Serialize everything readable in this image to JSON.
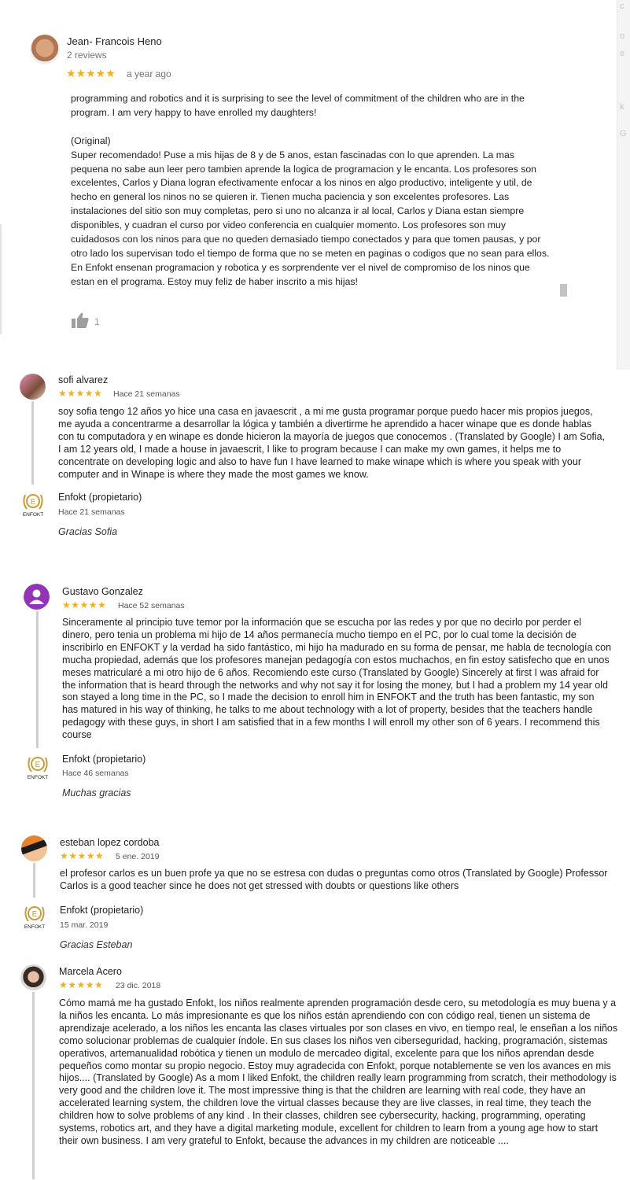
{
  "review1": {
    "name": "Jean- Francois Heno",
    "count": "2 reviews",
    "stars": "★★★★★",
    "date": "a year ago",
    "text": "programming and robotics and it is surprising to see the level of commitment of the children who are in the program. I am very happy to have enrolled my daughters!\n\n(Original)\nSuper recomendado! Puse a mis hijas de 8 y de 5 anos, estan fascinadas con lo que aprenden. La mas pequena no sabe aun leer pero tambien aprende la logica de programacion y le encanta. Los profesores son excelentes, Carlos y Diana logran efectivamente enfocar a los ninos en algo productivo, inteligente y util, de hecho en general los ninos no se quieren ir. Tienen mucha paciencia y son excelentes profesores. Las instalaciones del sitio son muy completas, pero si uno no alcanza ir al local, Carlos y Diana estan siempre disponibles, y cuadran el curso por video conferencia en cualquier momento. Los profesores son muy cuidadosos con los ninos para que no queden demasiado tiempo conectados y para que tomen pausas, y por otro lado los supervisan todo el tiempo de forma que no se meten en paginas o codigos que no sean para ellos. En Enfokt ensenan programacion y robotica y es sorprendente ver el nivel de compromiso de los ninos que estan en el programa. Estoy muy feliz de haber inscrito a mis hijas!",
    "likes": "1"
  },
  "review2": {
    "name": "sofi alvarez",
    "stars": "★★★★★",
    "date": "Hace 21 semanas",
    "text": "soy sofia tengo 12 años yo hice una casa en javaescrit , a mi me gusta programar porque puedo hacer mis propios juegos, me ayuda a concentrarme a desarrollar la lógica y también a divertirme he aprendido a hacer winape que es donde hablas con tu computadora y en winape es donde hicieron la mayoría de juegos que conocemos . (Translated by Google) I am Sofia, I am 12 years old, I made a house in javaescrit, I like to program because I can make my own games, it helps me to concentrate on developing logic and also to have fun I have learned to make winape which is where you speak with your computer and in Winape is where they made the most games we know.",
    "owner": "Enfokt (propietario)",
    "owner_date": "Hace 21 semanas",
    "reply": "Gracias Sofia"
  },
  "review3": {
    "name": "Gustavo Gonzalez",
    "stars": "★★★★★",
    "date": "Hace 52 semanas",
    "text": "Sinceramente al principio tuve temor por la información que se escucha por las redes y por que no decirlo por perder el dinero, pero tenia un problema mi hijo de 14 años permanecía mucho tiempo en el PC, por lo cual tome la decisión de inscribirlo en ENFOKT y la verdad ha sido fantástico, mi hijo ha madurado en su forma de pensar, me habla de tecnología con mucha propiedad, además que los profesores manejan pedagogía con estos muchachos, en fin estoy satisfecho que en unos meses matricularé a mi otro hijo de 6 años. Recomiendo este curso (Translated by Google) Sincerely at first I was afraid for the information that is heard through the networks and why not say it for losing the money, but I had a problem my 14 year old son stayed a long time in the PC, so I made the decision to enroll him in ENFOKT and the truth has been fantastic, my son has matured in his way of thinking, he talks to me about technology with a lot of property, besides that the teachers handle pedagogy with these guys, in short I am satisfied that in a few months I will enroll my other son of 6 years. I recommend this course",
    "owner": "Enfokt (propietario)",
    "owner_date": "Hace 46 semanas",
    "reply": "Muchas gracias"
  },
  "review4": {
    "name": "esteban lopez cordoba",
    "stars": "★★★★★",
    "date": "5 ene. 2019",
    "text": "el profesor carlos es un buen profe ya que no se estresa con dudas o preguntas como otros (Translated by Google) Professor Carlos is a good teacher since he does not get stressed with doubts or questions like others",
    "owner": "Enfokt (propietario)",
    "owner_date": "15 mar. 2019",
    "reply": "Gracias Esteban"
  },
  "review5": {
    "name": "Marcela Acero",
    "stars": "★★★★★",
    "date": "23 dic. 2018",
    "text": "Cómo mamá me ha gustado Enfokt, los niños realmente aprenden programación desde cero, su metodología es muy buena y a la niños les encanta. Lo más impresionante es que los niños están aprendiendo con con código real, tienen un sistema de aprendizaje acelerado, a los niños les encanta las clases virtuales por son clases en vivo, en tiempo real, le enseñan a los niños como solucionar problemas de cualquier índole. En sus clases los niños ven ciberseguridad, hacking, programación, sistemas operativos, artemanualidad robótica y tienen un modulo de mercadeo digital, excelente para que los niños aprendan desde pequeños como montar su propio negocio. Estoy muy agradecida con Enfokt, porque notablemente se ven los avances en mis hijos.... (Translated by Google) As a mom I liked Enfokt, the children really learn programming from scratch, their methodology is very good and the children love it. The most impressive thing is that the children are learning with real code, they have an accelerated learning system, the children love the virtual classes because they are live classes, in real time, they teach the children how to solve problems of any kind . In their classes, children see cybersecurity, hacking, programming, operating systems, robotics art, and they have a digital marketing module, excellent for children to learn from a young age how to start their own business. I am very grateful to Enfokt, because the advances in my children are noticeable ...."
  },
  "logo_text": "ENFOKT",
  "colors": {
    "star": "#f2b01e",
    "thread_line": "#cfcfcf",
    "owner_avatar_ring": "#c89b3c"
  }
}
